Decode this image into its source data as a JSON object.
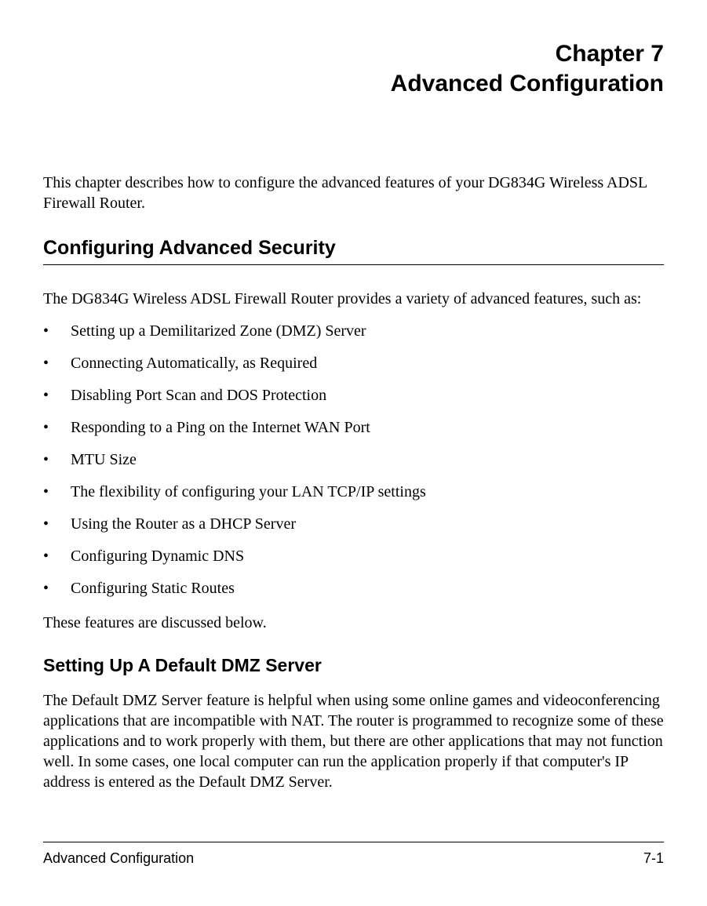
{
  "header": {
    "chapter_line": "Chapter 7",
    "chapter_title": "Advanced Configuration"
  },
  "intro": "This chapter describes how to configure the advanced features of your DG834G Wireless ADSL Firewall Router.",
  "section1": {
    "heading": "Configuring Advanced Security",
    "intro": "The DG834G Wireless ADSL Firewall Router provides a variety of advanced features, such as:",
    "bullets": [
      "Setting up a Demilitarized Zone (DMZ) Server",
      "Connecting Automatically, as Required",
      "Disabling Port Scan and DOS Protection",
      "Responding to a Ping on the Internet WAN Port",
      "MTU Size",
      "The flexibility of configuring your LAN TCP/IP settings",
      "Using the Router as a DHCP Server",
      "Configuring Dynamic DNS",
      "Configuring Static Routes"
    ],
    "closing": "These features are discussed below."
  },
  "section2": {
    "heading": "Setting Up A Default DMZ Server",
    "body": "The Default DMZ Server feature is helpful when using some online games and videoconferencing applications that are incompatible with NAT. The router is programmed to recognize some of these applications and to work properly with them, but there are other applications that may not function well. In some cases, one local computer can run the application properly if that computer's IP address is entered as the Default DMZ Server."
  },
  "footer": {
    "left": "Advanced Configuration",
    "right": "7-1"
  }
}
